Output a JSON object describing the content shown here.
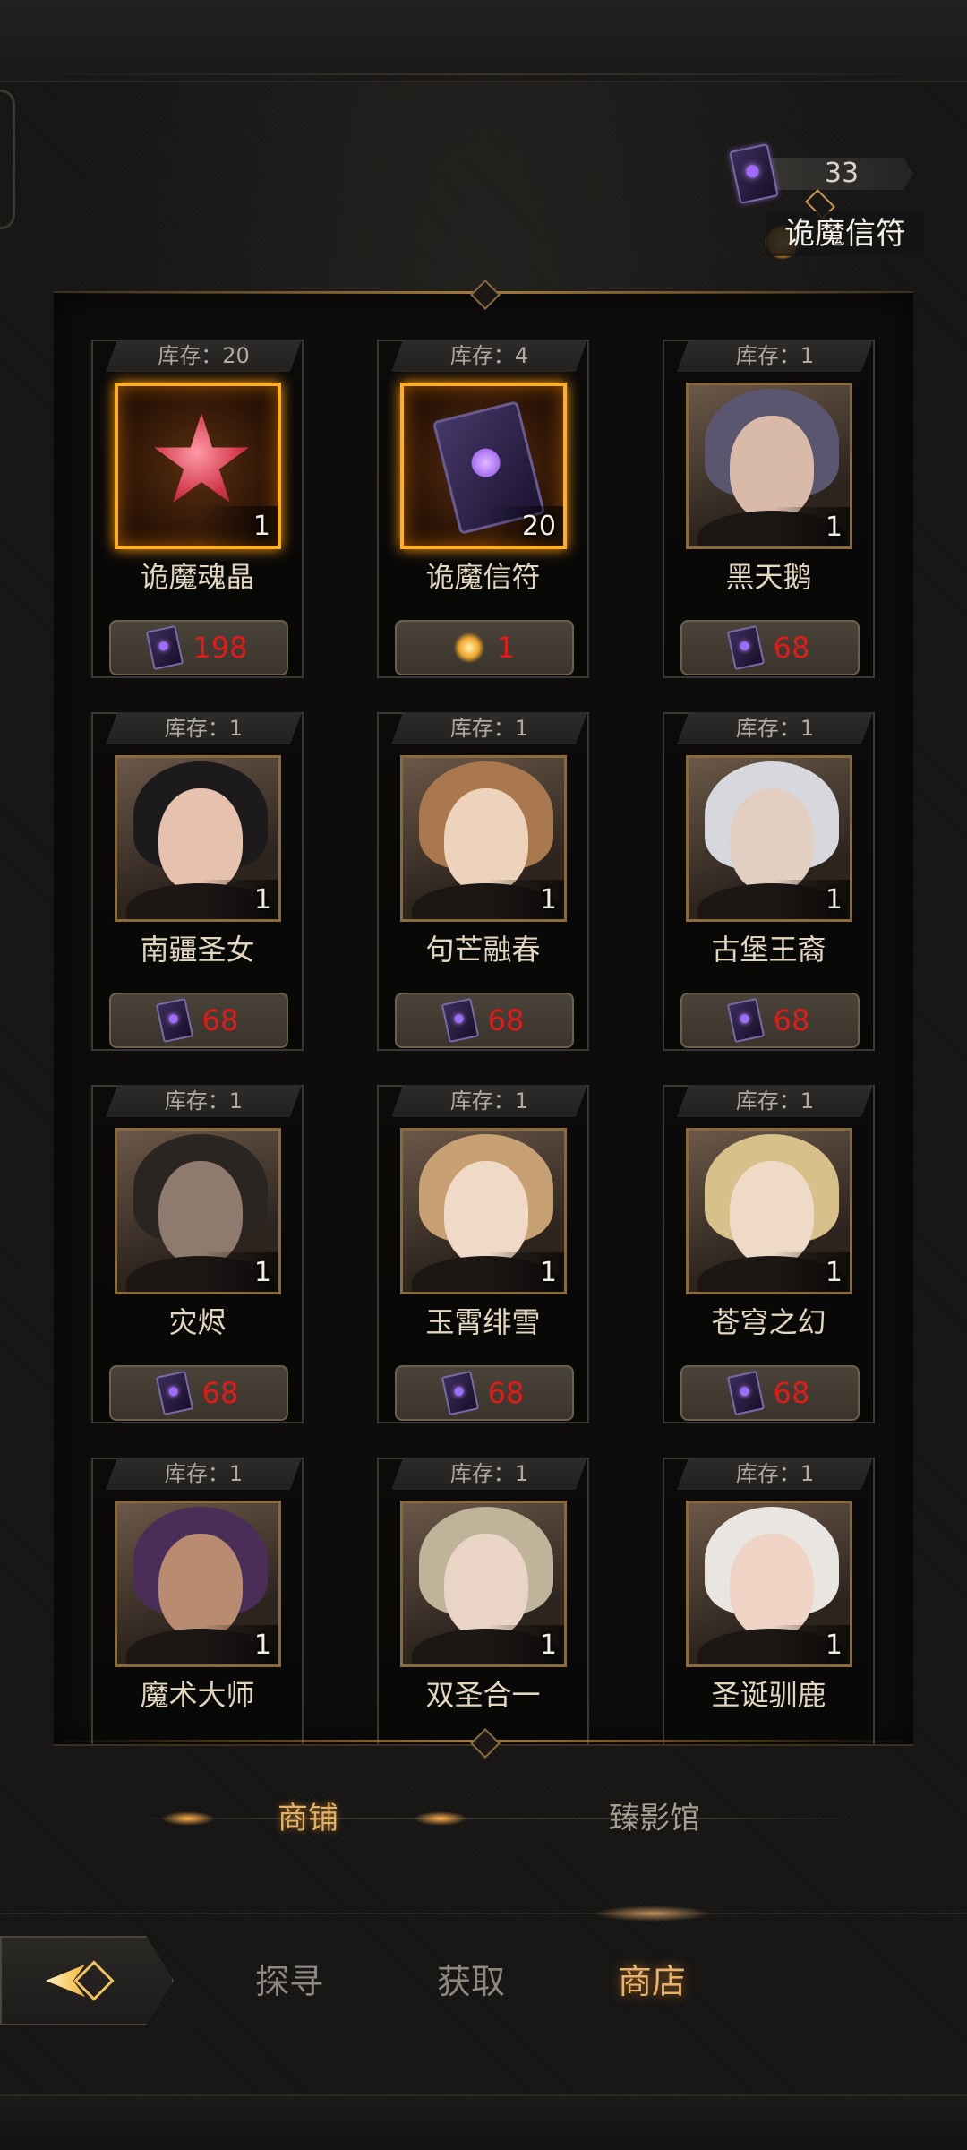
{
  "currency": {
    "amount": "33",
    "tooltip": "诡魔信符"
  },
  "items": [
    {
      "stock": "库存：20",
      "name": "诡魔魂晶",
      "qty": "1",
      "price": "198",
      "price_currency": "card-icon",
      "image": "crystal-star-icon",
      "highlight": true
    },
    {
      "stock": "库存：4",
      "name": "诡魔信符",
      "qty": "20",
      "price": "1",
      "price_currency": "gem-icon",
      "image": "demon-token-icon",
      "highlight": true
    },
    {
      "stock": "库存：1",
      "name": "黑天鹅",
      "qty": "1",
      "price": "68",
      "price_currency": "card-icon",
      "image": "portrait",
      "highlight": false
    },
    {
      "stock": "库存：1",
      "name": "南疆圣女",
      "qty": "1",
      "price": "68",
      "price_currency": "card-icon",
      "image": "portrait",
      "highlight": false
    },
    {
      "stock": "库存：1",
      "name": "句芒融春",
      "qty": "1",
      "price": "68",
      "price_currency": "card-icon",
      "image": "portrait",
      "highlight": false
    },
    {
      "stock": "库存：1",
      "name": "古堡王裔",
      "qty": "1",
      "price": "68",
      "price_currency": "card-icon",
      "image": "portrait",
      "highlight": false
    },
    {
      "stock": "库存：1",
      "name": "灾烬",
      "qty": "1",
      "price": "68",
      "price_currency": "card-icon",
      "image": "portrait",
      "highlight": false
    },
    {
      "stock": "库存：1",
      "name": "玉霄绯雪",
      "qty": "1",
      "price": "68",
      "price_currency": "card-icon",
      "image": "portrait",
      "highlight": false
    },
    {
      "stock": "库存：1",
      "name": "苍穹之幻",
      "qty": "1",
      "price": "68",
      "price_currency": "card-icon",
      "image": "portrait",
      "highlight": false
    },
    {
      "stock": "库存：1",
      "name": "魔术大师",
      "qty": "1",
      "price": "",
      "price_currency": "",
      "image": "portrait",
      "highlight": false
    },
    {
      "stock": "库存：1",
      "name": "双圣合一",
      "qty": "1",
      "price": "",
      "price_currency": "",
      "image": "portrait",
      "highlight": false
    },
    {
      "stock": "库存：1",
      "name": "圣诞驯鹿",
      "qty": "1",
      "price": "",
      "price_currency": "",
      "image": "portrait",
      "highlight": false
    }
  ],
  "subtabs": [
    {
      "label": "商铺",
      "active": true
    },
    {
      "label": "臻影馆",
      "active": false
    }
  ],
  "nav": [
    {
      "label": "探寻",
      "active": false
    },
    {
      "label": "获取",
      "active": false
    },
    {
      "label": "商店",
      "active": true
    }
  ],
  "colors": {
    "accent_gold": "#e6b26c",
    "price_red": "#e11a1a",
    "highlight_orange": "#ffb020"
  }
}
